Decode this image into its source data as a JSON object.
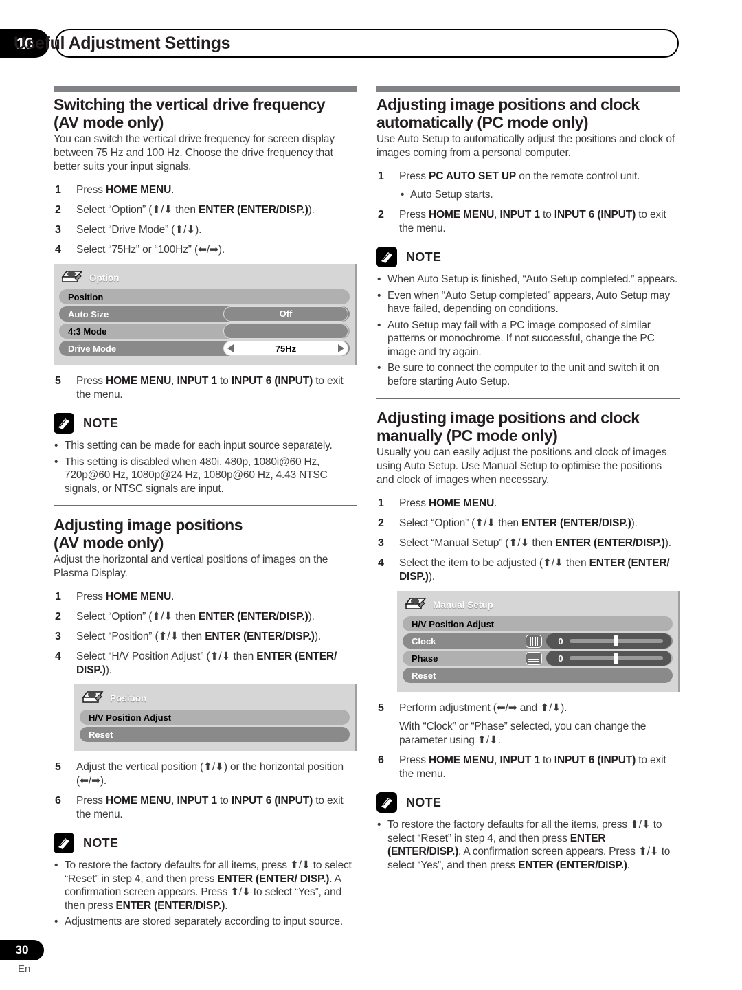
{
  "header": {
    "chapter_number": "10",
    "title": "Useful Adjustment Settings"
  },
  "footer": {
    "page_number": "30",
    "language": "En"
  },
  "note_label": "NOTE",
  "left_column": {
    "section1": {
      "title_line1": "Switching the vertical drive frequency",
      "title_line2": "(AV mode only)",
      "intro": "You can switch the vertical drive frequency for screen display between 75 Hz and 100 Hz. Choose the drive frequency that better suits your input signals.",
      "steps": [
        {
          "num": "1",
          "html": "Press <b>HOME MENU</b>."
        },
        {
          "num": "2",
          "html": "Select “Option” (⬆/⬇ then <b>ENTER (ENTER/DISP.)</b>)."
        },
        {
          "num": "3",
          "html": "Select “Drive Mode” (⬆/⬇)."
        },
        {
          "num": "4",
          "html": "Select “75Hz” or “100Hz” (⬅/➡)."
        }
      ],
      "osd": {
        "title": "Option",
        "icon": "projector-icon",
        "rows": [
          {
            "label": "Position",
            "style": "light",
            "control": "none"
          },
          {
            "label": "Auto Size",
            "style": "dark",
            "control": "pill",
            "value": "Off"
          },
          {
            "label": "4:3 Mode",
            "style": "light",
            "control": "pill",
            "value": ""
          },
          {
            "label": "Drive Mode",
            "style": "dark",
            "control": "spinner",
            "value": "75Hz"
          }
        ]
      },
      "steps_after": [
        {
          "num": "5",
          "html": "Press <b>HOME MENU</b>, <b>INPUT 1</b> to <b>INPUT 6 (INPUT)</b> to exit the menu."
        }
      ],
      "notes": [
        "This setting can be made for each input source separately.",
        "This setting is disabled when 480i, 480p, 1080i@60 Hz, 720p@60 Hz, 1080p@24 Hz, 1080p@60 Hz, 4.43 NTSC signals, or NTSC signals are input."
      ]
    },
    "section2": {
      "title_line1": "Adjusting image positions",
      "title_line2": "(AV mode only)",
      "intro": "Adjust the horizontal and vertical positions of images on the Plasma Display.",
      "steps": [
        {
          "num": "1",
          "html": "Press <b>HOME MENU</b>."
        },
        {
          "num": "2",
          "html": "Select “Option” (⬆/⬇ then <b>ENTER (ENTER/DISP.)</b>)."
        },
        {
          "num": "3",
          "html": "Select “Position” (⬆/⬇ then <b>ENTER (ENTER/DISP.)</b>)."
        },
        {
          "num": "4",
          "html": "Select “H/V Position Adjust” (⬆/⬇ then <b>ENTER (ENTER/ DISP.)</b>)."
        }
      ],
      "osd": {
        "title": "Position",
        "icon": "projector-icon",
        "rows": [
          {
            "label": "H/V Position Adjust",
            "style": "light",
            "control": "none"
          },
          {
            "label": "Reset",
            "style": "dark",
            "control": "none"
          }
        ]
      },
      "steps_after": [
        {
          "num": "5",
          "html": "Adjust the vertical position (⬆/⬇) or the horizontal position  (⬅/➡)."
        },
        {
          "num": "6",
          "html": "Press <b>HOME MENU</b>, <b>INPUT 1</b> to <b>INPUT 6 (INPUT)</b> to exit the menu."
        }
      ],
      "notes": [
        "To restore the factory defaults for all items, press ⬆/⬇ to select “Reset” in step 4, and then press <b>ENTER (ENTER/ DISP.)</b>. A confirmation screen appears. Press ⬆/⬇ to select “Yes”, and then press <b>ENTER (ENTER/DISP.)</b>.",
        "Adjustments are stored separately according to input source."
      ]
    }
  },
  "right_column": {
    "section1": {
      "title_line1": "Adjusting image positions and clock",
      "title_line2": "automatically (PC mode only)",
      "intro": "Use Auto Setup to automatically adjust the positions and clock of images coming from a personal computer.",
      "steps": [
        {
          "num": "1",
          "html": "Press <b>PC AUTO SET UP</b> on the remote control unit.",
          "substep": "Auto Setup starts."
        },
        {
          "num": "2",
          "html": "Press <b>HOME MENU</b>, <b>INPUT 1</b> to <b>INPUT 6 (INPUT)</b> to exit the menu."
        }
      ],
      "notes": [
        "When Auto Setup is finished, “Auto Setup completed.” appears.",
        "Even when “Auto Setup completed” appears, Auto Setup may have failed, depending on conditions.",
        "Auto Setup may fail with a PC image composed of similar patterns or monochrome. If not successful, change the PC image and try again.",
        "Be sure to connect the computer to the unit and switch it on before starting Auto Setup."
      ]
    },
    "section2": {
      "title_line1": "Adjusting image positions and clock",
      "title_line2": "manually (PC mode only)",
      "intro": "Usually you can easily adjust the positions and clock of images using Auto Setup. Use Manual Setup to optimise the positions and clock of images when necessary.",
      "steps": [
        {
          "num": "1",
          "html": "Press <b>HOME MENU</b>."
        },
        {
          "num": "2",
          "html": "Select “Option” (⬆/⬇ then <b>ENTER (ENTER/DISP.)</b>)."
        },
        {
          "num": "3",
          "html": "Select “Manual Setup” (⬆/⬇ then <b>ENTER (ENTER/DISP.)</b>)."
        },
        {
          "num": "4",
          "html": "Select the item to be adjusted (⬆/⬇ then <b>ENTER (ENTER/ DISP.)</b>)."
        }
      ],
      "osd": {
        "title": "Manual Setup",
        "icon": "projector-icon",
        "rows": [
          {
            "label": "H/V Position Adjust",
            "style": "light",
            "control": "none"
          },
          {
            "label": "Clock",
            "style": "dark",
            "control": "slider",
            "value": "0",
            "icon": "vertical-bars-icon"
          },
          {
            "label": "Phase",
            "style": "light",
            "control": "slider",
            "value": "0",
            "icon": "horizontal-lines-icon"
          },
          {
            "label": "Reset",
            "style": "dark",
            "control": "none"
          }
        ]
      },
      "steps_after": [
        {
          "num": "5",
          "html": "Perform adjustment (⬅/➡ and ⬆/⬇).",
          "extra": "With “Clock” or “Phase” selected, you can change the parameter using ⬆/⬇."
        },
        {
          "num": "6",
          "html": "Press <b>HOME MENU</b>, <b>INPUT 1</b> to <b>INPUT 6 (INPUT)</b> to exit the menu."
        }
      ],
      "notes": [
        "To restore the factory defaults for all the items, press ⬆/⬇ to select “Reset” in step 4, and then press <b>ENTER (ENTER/DISP.)</b>. A confirmation screen appears. Press ⬆/⬇ to select “Yes”, and then press <b>ENTER (ENTER/DISP.)</b>."
      ]
    }
  }
}
